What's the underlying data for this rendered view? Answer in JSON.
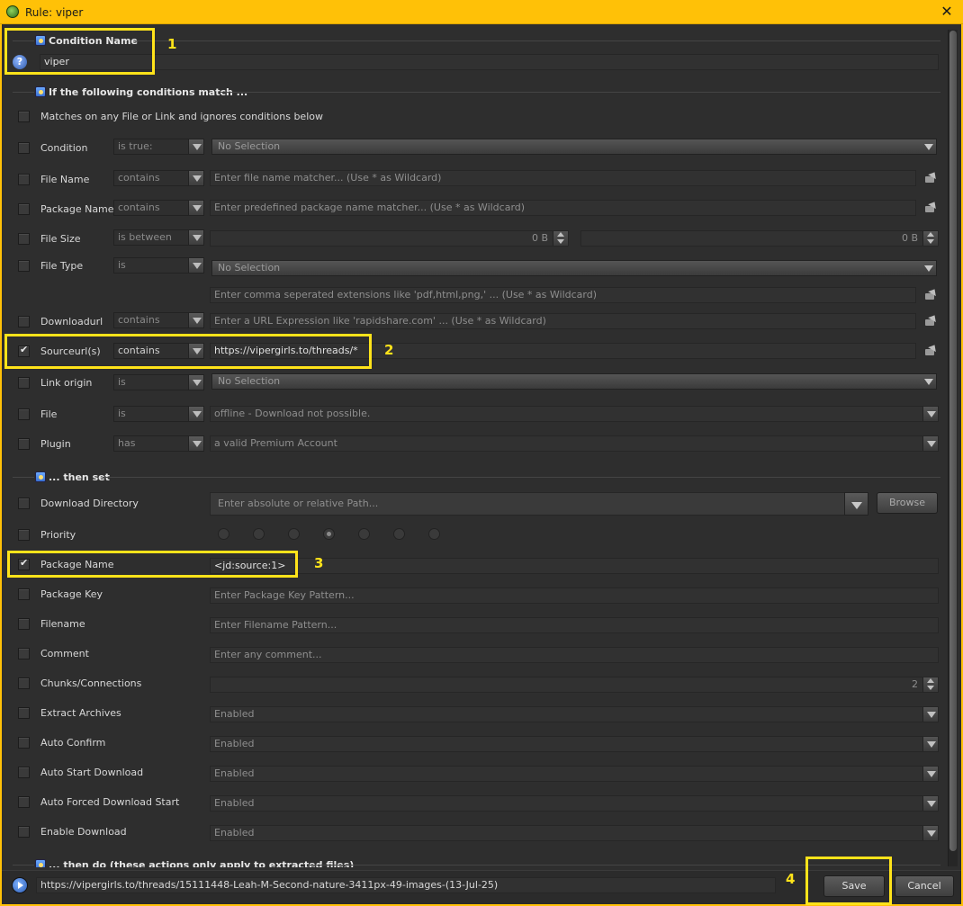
{
  "window": {
    "title": "Rule: viper",
    "close_glyph": "✕"
  },
  "condition_name": {
    "section_title": "Condition Name",
    "value": "viper",
    "help_glyph": "?"
  },
  "conditions": {
    "section_title": "If the following conditions match ...",
    "match_any_label": "Matches on any File or Link and ignores conditions below",
    "rows": [
      {
        "label": "Condition",
        "op": "is true:",
        "value": "No Selection",
        "checked": false
      },
      {
        "label": "File Name",
        "op": "contains",
        "placeholder": "Enter file name matcher... (Use * as Wildcard)",
        "checked": false
      },
      {
        "label": "Package Name",
        "op": "contains",
        "placeholder": "Enter predefined package name matcher... (Use * as Wildcard)",
        "checked": false
      },
      {
        "label": "File Size",
        "op": "is between",
        "min": "0 B",
        "max": "0 B",
        "checked": false
      },
      {
        "label": "File Type",
        "op": "is",
        "value": "No Selection",
        "ext_placeholder": "Enter comma seperated extensions like 'pdf,html,png,' ... (Use * as Wildcard)",
        "checked": false
      },
      {
        "label": "Downloadurl",
        "op": "contains",
        "placeholder": "Enter a URL Expression like 'rapidshare.com' ... (Use * as Wildcard)",
        "checked": false
      },
      {
        "label": "Sourceurl(s)",
        "op": "contains",
        "value": "https://vipergirls.to/threads/*",
        "checked": true
      },
      {
        "label": "Link origin",
        "op": "is",
        "value": "No Selection",
        "checked": false
      },
      {
        "label": "File",
        "op": "is",
        "value": "offline - Download not possible.",
        "checked": false
      },
      {
        "label": "Plugin",
        "op": "has",
        "value": "a valid Premium Account",
        "checked": false
      }
    ]
  },
  "then_set": {
    "section_title": "... then set",
    "download_directory": {
      "label": "Download Directory",
      "placeholder": "Enter absolute or relative Path...",
      "browse": "Browse",
      "checked": false
    },
    "priority": {
      "label": "Priority",
      "selected_index": 3,
      "count": 7,
      "checked": false
    },
    "package_name": {
      "label": "Package Name",
      "value": "<jd:source:1>",
      "checked": true
    },
    "package_key": {
      "label": "Package Key",
      "placeholder": "Enter Package Key Pattern...",
      "checked": false
    },
    "filename": {
      "label": "Filename",
      "placeholder": "Enter Filename Pattern...",
      "checked": false
    },
    "comment": {
      "label": "Comment",
      "placeholder": "Enter any comment...",
      "checked": false
    },
    "chunks": {
      "label": "Chunks/Connections",
      "value": "2",
      "checked": false
    },
    "extract": {
      "label": "Extract Archives",
      "value": "Enabled",
      "checked": false
    },
    "auto_confirm": {
      "label": "Auto Confirm",
      "value": "Enabled",
      "checked": false
    },
    "auto_start": {
      "label": "Auto Start Download",
      "value": "Enabled",
      "checked": false
    },
    "auto_forced": {
      "label": "Auto Forced Download Start",
      "value": "Enabled",
      "checked": false
    },
    "enable_download": {
      "label": "Enable Download",
      "value": "Enabled",
      "checked": false
    }
  },
  "then_do": {
    "section_title": "... then do (these actions only apply to extracted files)"
  },
  "footer": {
    "test_url": "https://vipergirls.to/threads/15111448-Leah-M-Second-nature-3411px-49-images-(13-Jul-25)",
    "save": "Save",
    "cancel": "Cancel"
  },
  "annotations": [
    "1",
    "2",
    "3",
    "4"
  ],
  "colors": {
    "titlebar": "#ffc107",
    "highlight": "#ffe31a",
    "background": "#2e2e2e"
  }
}
